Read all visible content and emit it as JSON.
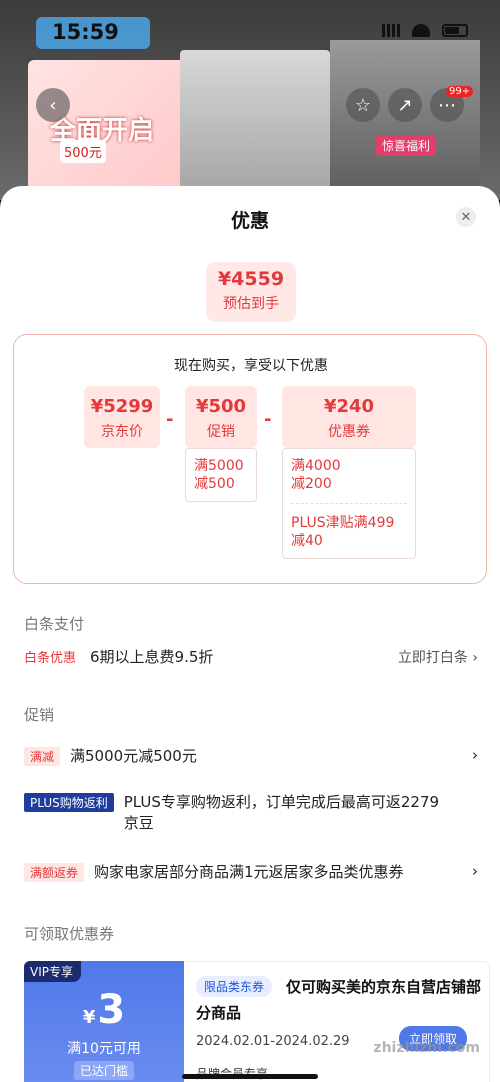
{
  "status_bar": {
    "time": "15:59"
  },
  "background": {
    "promo_main": "全面开启",
    "promo_sub": "500元",
    "tag": "惊喜福利",
    "badge": "99+"
  },
  "sheet": {
    "title": "优惠",
    "close_icon": "close-icon",
    "estimate": {
      "price": "¥4559",
      "label": "预估到手"
    },
    "detail": {
      "heading": "现在购买，享受以下优惠",
      "cards": [
        {
          "amount": "¥5299",
          "label": "京东价"
        },
        {
          "amount": "¥500",
          "label": "促销"
        },
        {
          "amount": "¥240",
          "label": "优惠券"
        }
      ],
      "operators": [
        "-",
        "-"
      ],
      "promo_breakdown": {
        "line1": "满5000",
        "line2": "减500"
      },
      "coupon_breakdown": [
        {
          "line1": "满4000",
          "line2": "减200"
        },
        {
          "line1": "PLUS津贴满499",
          "line2": "减40"
        }
      ]
    },
    "baitiao": {
      "section_title": "白条支付",
      "tag": "白条优惠",
      "text": "6期以上息费9.5折",
      "link": "立即打白条 ›"
    },
    "promotions": {
      "section_title": "促销",
      "items": [
        {
          "tag": "满减",
          "text": "满5000元减500元",
          "chevron": "›"
        },
        {
          "tag": "PLUS购物返利",
          "text": "PLUS专享购物返利，订单完成后最高可返2279京豆"
        },
        {
          "tag": "满额返券",
          "text": "购家电家居部分商品满1元返居家多品类优惠券",
          "chevron": "›"
        }
      ]
    },
    "coupons": {
      "section_title": "可领取优惠券",
      "card": {
        "vip_tag": "VIP专享",
        "currency": "¥",
        "amount": "3",
        "condition": "满10元可用",
        "status": "已达门槛",
        "kind": "限品类东券",
        "description": "仅可购买美的京东自营店铺部分商品",
        "date_range": "2024.02.01-2024.02.29",
        "brand_note": "品牌会员专享",
        "button": "立即领取"
      }
    }
  },
  "watermark": "zhizhizhi.com",
  "colors": {
    "accent": "#e4393c",
    "accent_light": "#ffe6e3",
    "coupon_blue": "#4f78e8",
    "plus_blue": "#1e3c9e"
  }
}
